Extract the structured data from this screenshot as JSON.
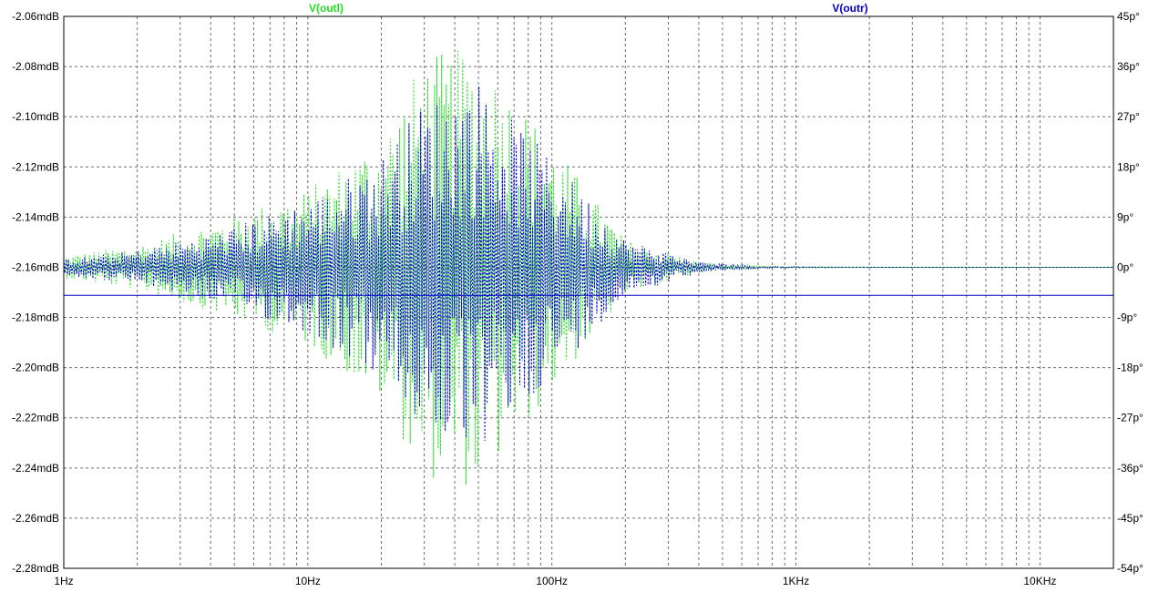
{
  "colors": {
    "background": "#ffffff",
    "grid": "#6f6f6f",
    "axis": "#000000",
    "outl": "#22dd22",
    "outr": "#0000cc"
  },
  "chart_data": {
    "type": "line",
    "x_scale": "log",
    "xlim": [
      1,
      20000
    ],
    "x_tick_labels": [
      {
        "value": 1,
        "label": "1Hz"
      },
      {
        "value": 10,
        "label": "10Hz"
      },
      {
        "value": 100,
        "label": "100Hz"
      },
      {
        "value": 1000,
        "label": "1KHz"
      },
      {
        "value": 10000,
        "label": "10KHz"
      }
    ],
    "ylim_left": [
      -2.28,
      -2.06
    ],
    "y_tick_labels_left": [
      "-2.06mdB",
      "-2.08mdB",
      "-2.10mdB",
      "-2.12mdB",
      "-2.14mdB",
      "-2.16mdB",
      "-2.18mdB",
      "-2.20mdB",
      "-2.22mdB",
      "-2.24mdB",
      "-2.26mdB",
      "-2.28mdB"
    ],
    "ylim_right": [
      -54,
      45
    ],
    "y_tick_labels_right": [
      "45p°",
      "36p°",
      "27p°",
      "18p°",
      "9p°",
      "0p°",
      "-9p°",
      "-18p°",
      "-27p°",
      "-36p°",
      "-45p°",
      "-54p°"
    ],
    "grid": true,
    "series": [
      {
        "name": "V(outl)",
        "color": "#22dd22",
        "style": "dotted",
        "center": 0,
        "noise_envelope": [
          [
            1,
            2
          ],
          [
            2,
            4
          ],
          [
            4,
            8
          ],
          [
            10,
            14
          ],
          [
            20,
            24
          ],
          [
            30,
            38
          ],
          [
            50,
            40
          ],
          [
            80,
            28
          ],
          [
            120,
            18
          ],
          [
            200,
            5
          ],
          [
            400,
            1
          ],
          [
            700,
            0.2
          ],
          [
            2000,
            0
          ]
        ]
      },
      {
        "name": "V(outr)",
        "color": "#0000cc",
        "style": "dotted",
        "center": 0,
        "noise_envelope": [
          [
            1,
            1.5
          ],
          [
            2,
            3
          ],
          [
            4,
            6
          ],
          [
            10,
            12
          ],
          [
            20,
            20
          ],
          [
            30,
            30
          ],
          [
            50,
            34
          ],
          [
            80,
            24
          ],
          [
            120,
            16
          ],
          [
            200,
            5
          ],
          [
            400,
            1
          ],
          [
            700,
            0.2
          ],
          [
            2000,
            0
          ]
        ]
      },
      {
        "name": "V(outr) magnitude",
        "color": "#0000cc",
        "style": "solid",
        "constant": -2.1712
      }
    ]
  }
}
